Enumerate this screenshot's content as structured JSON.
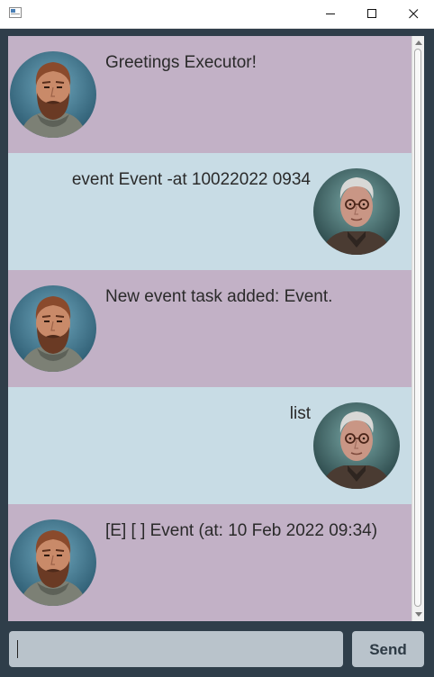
{
  "window": {
    "title": "",
    "controls": [
      "minimize-icon",
      "maximize-icon",
      "close-icon"
    ]
  },
  "dialogs": [
    {
      "speaker": "duke",
      "text": "Greetings Executor!"
    },
    {
      "speaker": "user",
      "text": "event Event -at 10022022 0934"
    },
    {
      "speaker": "duke",
      "text": "New event task added: Event."
    },
    {
      "speaker": "user",
      "text": "list"
    },
    {
      "speaker": "duke",
      "text": "[E] [ ] Event (at: 10 Feb 2022 09:34)"
    }
  ],
  "input": {
    "value": "",
    "placeholder": ""
  },
  "send_button": {
    "label": "Send"
  },
  "colors": {
    "window_bg": "#2f3e4a",
    "bot_dialog_bg": "#c2b1c6",
    "user_dialog_bg": "#c8dce5",
    "input_bg": "#b9c3cb",
    "button_text": "#2d3a44"
  }
}
